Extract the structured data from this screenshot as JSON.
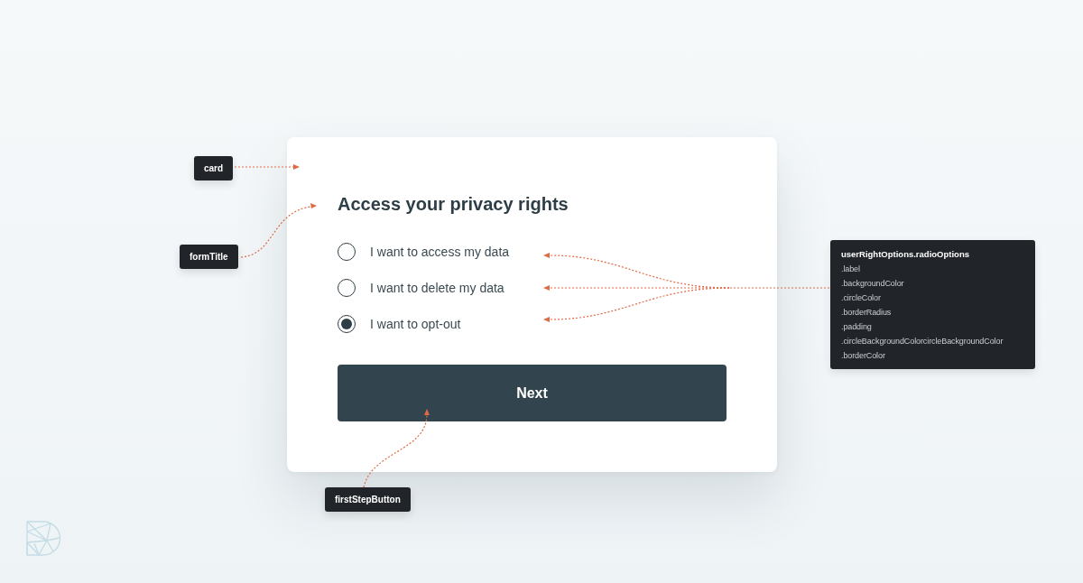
{
  "card": {
    "title": "Access your privacy rights",
    "options": [
      {
        "label": "I want to access my data",
        "selected": false
      },
      {
        "label": "I want to delete my data",
        "selected": false
      },
      {
        "label": "I want to opt-out",
        "selected": true
      }
    ],
    "button": {
      "label": "Next"
    }
  },
  "callouts": [
    {
      "label": "card"
    },
    {
      "label": "formTitle"
    },
    {
      "label": "firstStepButton"
    }
  ],
  "properties_panel": {
    "title": "userRightOptions.radioOptions",
    "items": [
      ".label",
      ".backgroundColor",
      ".circleColor",
      ".borderRadius",
      ".padding",
      ".circleBackgroundColorcircleBackgroundColor",
      ".borderColor"
    ]
  }
}
